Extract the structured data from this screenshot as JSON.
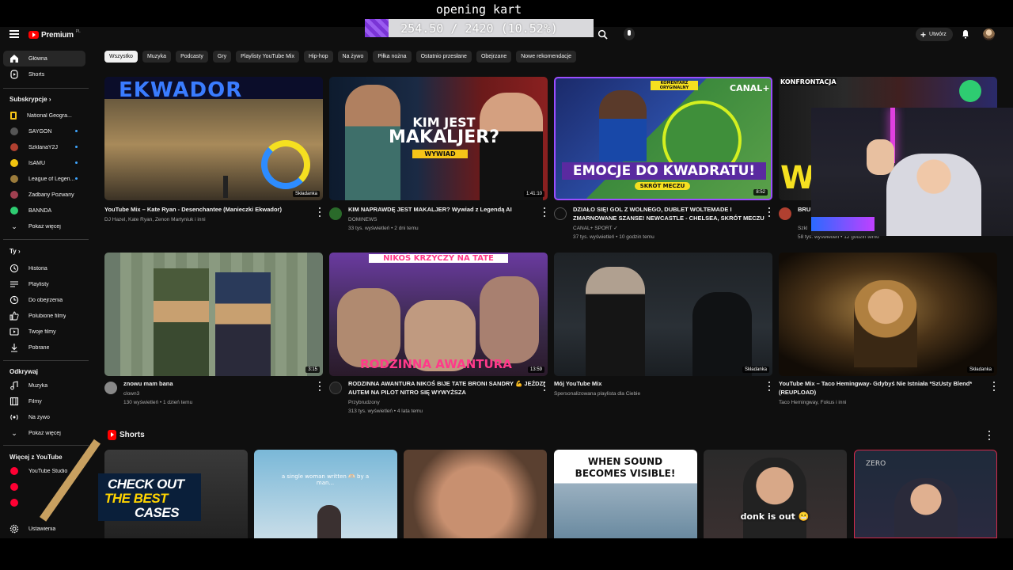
{
  "overlay": {
    "title": "opening kart",
    "progress_text": "254.50 / 2420 (10.52%)",
    "progress_fraction": 0.1052
  },
  "header": {
    "logo_text": "Premium",
    "logo_sup": "PL",
    "create_label": "Utwórz"
  },
  "sidebar": {
    "main": [
      {
        "label": "Główna"
      },
      {
        "label": "Shorts"
      }
    ],
    "subscriptions_title": "Subskrypcje",
    "channels": [
      {
        "label": "National Geogra...",
        "color": "#f5c518"
      },
      {
        "label": "SAYGON",
        "color": "#444"
      },
      {
        "label": "SzklanaY2J",
        "color": "#c0392b"
      },
      {
        "label": "IsAMU",
        "color": "#f1c40f"
      },
      {
        "label": "League of Legen...",
        "color": "#9b7b3b"
      },
      {
        "label": "Zadbany Pozwany",
        "color": "#a04050"
      },
      {
        "label": "BANNDA",
        "color": "#2ecc71"
      }
    ],
    "show_more": "Pokaż więcej",
    "you_title": "Ty",
    "you_items": [
      {
        "label": "Historia"
      },
      {
        "label": "Playlisty"
      },
      {
        "label": "Do obejrzenia"
      },
      {
        "label": "Polubione filmy"
      },
      {
        "label": "Twoje filmy"
      },
      {
        "label": "Pobrane"
      }
    ],
    "explore_title": "Odkrywaj",
    "explore_items": [
      {
        "label": "Muzyka"
      },
      {
        "label": "Filmy"
      },
      {
        "label": "Na żywo"
      },
      {
        "label": "Pokaż więcej"
      }
    ],
    "more_title": "Więcej z YouTube",
    "more_items": [
      {
        "label": "YouTube Studio"
      }
    ],
    "settings": "Ustawienia"
  },
  "chips": [
    "Wszystko",
    "Muzyka",
    "Podcasty",
    "Gry",
    "Playlisty YouTube Mix",
    "Hip-hop",
    "Na żywo",
    "Piłka nożna",
    "Ostatnio przesłane",
    "Obejrzane",
    "Nowe rekomendacje"
  ],
  "videos": [
    {
      "title": "YouTube Mix – Kate Ryan - Desenchantee (Manieczki Ekwador)",
      "meta1": "DJ Hazel, Kate Ryan, Zenon Martyniuk i inni",
      "meta2": "",
      "badge": "Składanka"
    },
    {
      "title": "KIM NAPRAWDĘ JEST MAKALJER? Wywiad z Legendą AI",
      "meta1": "DOMINEWS",
      "meta2": "33 tys. wyświetleń • 2 dni temu",
      "badge": "1:41:10",
      "thumb_l1": "KIM JEST",
      "thumb_l2": "MAKALJER?",
      "thumb_l3": "WYWIAD"
    },
    {
      "title": "DZIAŁO SIĘ! GOL Z WOLNEGO, DUBLET WOLTEMADE I ZMARNOWANE SZANSE! NEWCASTLE - CHELSEA, SKRÓT MECZU",
      "meta1": "CANAL+ SPORT ✓",
      "meta2": "37 tys. wyświetleń • 10 godzin temu",
      "badge": "8:52",
      "thumb_l1": "EMOCJE DO KWADRATU!",
      "thumb_l2": "SKRÓT MECZU",
      "thumb_l3": "CANAL+",
      "thumb_l4": "KOMENTARZ ORYGINALNY"
    },
    {
      "title": "BRU BRO",
      "meta1": "Szkl",
      "meta2": "58 tys. wyświetleń • 12 godzin temu",
      "badge": "",
      "thumb_l1": "KONFRONTACJA",
      "thumb_l2": "WJ"
    },
    {
      "title": "znowu mam  bana",
      "meta1": "clown3",
      "meta2": "130 wyświetleń • 1 dzień temu",
      "badge": "3:15"
    },
    {
      "title": "RODZINNA AWANTURA NIKOŚ BIJE TATE BRONI SANDRY 💪 JEŹDZI AUTEM NA PILOT NITRO SIĘ WYWYŻSZA",
      "meta1": "Przybrudzony",
      "meta2": "313 tys. wyświetleń • 4 lata temu",
      "badge": "13:59",
      "thumb_l1": "NIKOŚ KRZYCZY NA TATE",
      "thumb_l2": "RODZINNA AWANTURA"
    },
    {
      "title": "Mój YouTube Mix",
      "meta1": "Spersonalizowana playlista dla Ciebie",
      "meta2": "",
      "badge": "Składanka"
    },
    {
      "title": "YouTube Mix – Taco Hemingway- Gdybyś Nie Istniała *SzUsty Blend* (REUPLOAD)",
      "meta1": "Taco Hemingway, Fokus i inni",
      "meta2": "",
      "badge": "Składanka"
    }
  ],
  "shorts": {
    "title": "Shorts",
    "items": [
      {
        "caption": ""
      },
      {
        "caption": "a single woman written 🫶🏻 by a man..."
      },
      {
        "caption": ""
      },
      {
        "caption": "WHEN SOUND BECOMES VISIBLE!"
      },
      {
        "caption": "donk is out 😬"
      },
      {
        "caption": "ZERO"
      }
    ]
  },
  "promo": {
    "line1": "CHECK OUT",
    "line2": "THE BEST",
    "line3": "CASES"
  },
  "thumb1_sign": "EKWADOR"
}
